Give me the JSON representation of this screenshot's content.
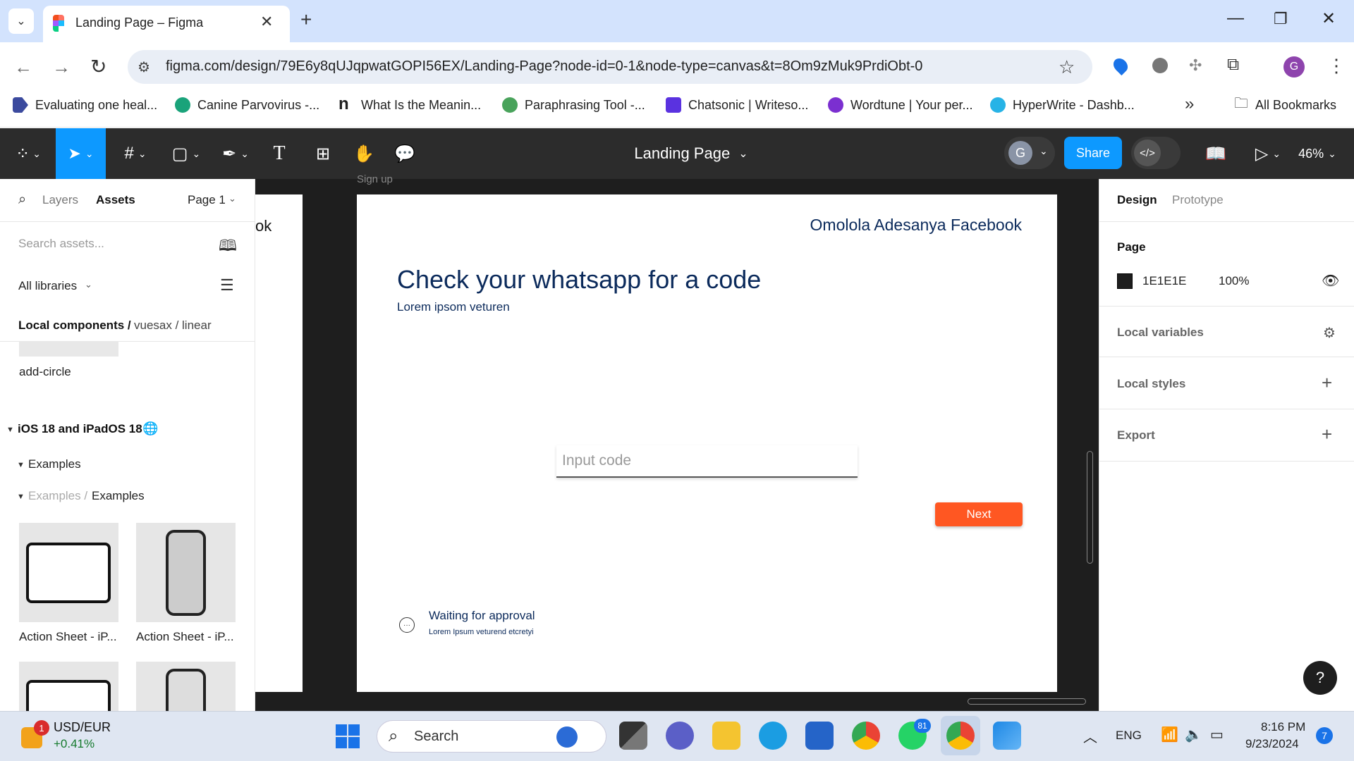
{
  "browser": {
    "tab_title": "Landing Page – Figma",
    "new_tab": "+",
    "url": "figma.com/design/79E6y8qUJqpwatGOPI56EX/Landing-Page?node-id=0-1&node-type=canvas&t=8Om9zMuk9PrdiObt-0",
    "avatar": "G",
    "bookmarks": [
      "Evaluating one heal...",
      "Canine Parvovirus -...",
      "What Is the Meanin...",
      "Paraphrasing Tool -...",
      "Chatsonic | Writeso...",
      "Wordtune | Your per...",
      "HyperWrite - Dashb..."
    ],
    "more": "»",
    "all_bookmarks": "All Bookmarks"
  },
  "figma": {
    "file_title": "Landing Page",
    "share": "Share",
    "user": "G",
    "zoom": "46%",
    "left": {
      "tab_layers": "Layers",
      "tab_assets": "Assets",
      "page": "Page 1",
      "search_placeholder": "Search assets...",
      "libraries": "All libraries",
      "breadcrumb_bold": "Local components /",
      "breadcrumb_rest": "vuesax / linear",
      "component": "add-circle",
      "lib_name": "iOS 18 and iPadOS 18",
      "group": "Examples",
      "sub_dim": "Examples /",
      "sub": "Examples",
      "thumbs": [
        "Action Sheet - iP...",
        "Action Sheet - iP..."
      ]
    },
    "canvas": {
      "frame_label": "Sign up",
      "side_text": "ok",
      "brand": "Omolola Adesanya Facebook",
      "heading": "Check your whatsapp for a code",
      "sub": "Lorem ipsom veturen",
      "input_placeholder": "Input code",
      "next": "Next",
      "status_title": "Waiting for approval",
      "status_sub": "Lorem Ipsum veturend etcretyi"
    },
    "right": {
      "tab_design": "Design",
      "tab_prototype": "Prototype",
      "page_label": "Page",
      "page_color": "1E1E1E",
      "page_opacity": "100%",
      "local_variables": "Local variables",
      "local_styles": "Local styles",
      "export": "Export",
      "help": "?"
    },
    "colors": {
      "accent": "#0d99ff",
      "next": "#ff5722",
      "navy": "#0b2a5b"
    }
  },
  "taskbar": {
    "widget_badge": "1",
    "ticker": "USD/EUR",
    "change": "+0.41%",
    "search": "Search",
    "whatsapp_badge": "81",
    "lang": "ENG",
    "time": "8:16 PM",
    "date": "9/23/2024",
    "notif": "7"
  }
}
